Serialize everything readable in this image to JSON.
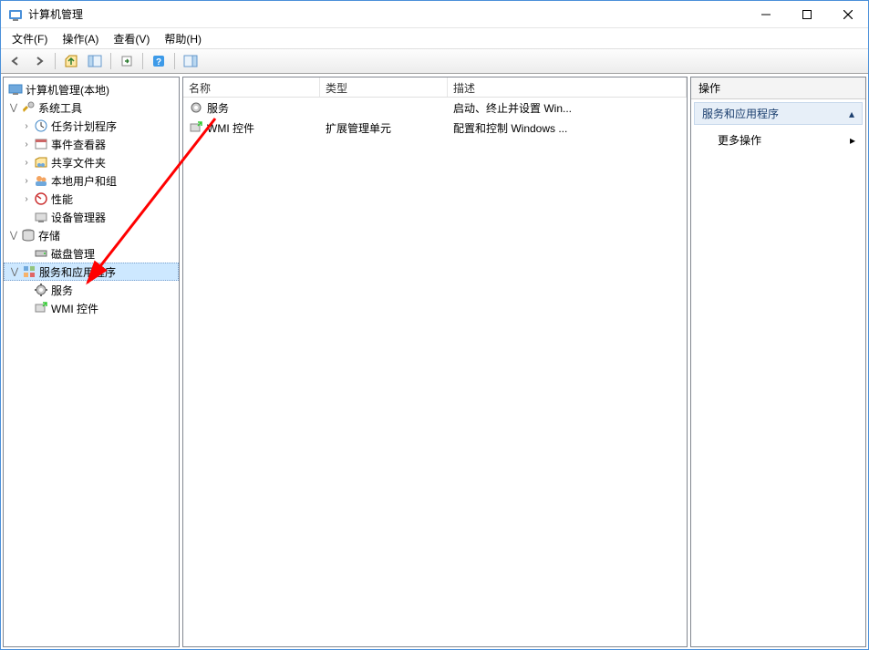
{
  "window": {
    "title": "计算机管理"
  },
  "menubar": {
    "file": "文件(F)",
    "action": "操作(A)",
    "view": "查看(V)",
    "help": "帮助(H)"
  },
  "tree": {
    "root": "计算机管理(本地)",
    "system_tools": "系统工具",
    "task_scheduler": "任务计划程序",
    "event_viewer": "事件查看器",
    "shared_folders": "共享文件夹",
    "local_users": "本地用户和组",
    "performance": "性能",
    "device_manager": "设备管理器",
    "storage": "存储",
    "disk_management": "磁盘管理",
    "services_apps": "服务和应用程序",
    "services": "服务",
    "wmi": "WMI 控件"
  },
  "list": {
    "columns": {
      "name": "名称",
      "type": "类型",
      "desc": "描述"
    },
    "rows": [
      {
        "name": "服务",
        "type": "",
        "desc": "启动、终止并设置 Win..."
      },
      {
        "name": "WMI 控件",
        "type": "扩展管理单元",
        "desc": "配置和控制 Windows ..."
      }
    ]
  },
  "actions": {
    "header": "操作",
    "group": "服务和应用程序",
    "more": "更多操作"
  }
}
